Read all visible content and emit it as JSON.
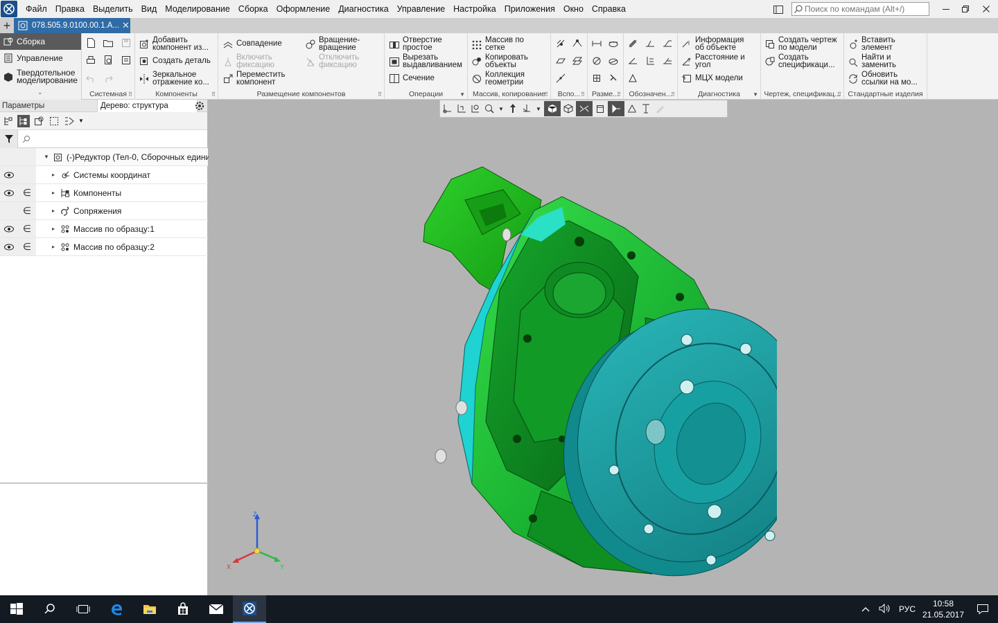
{
  "menubar": {
    "items": [
      "Файл",
      "Правка",
      "Выделить",
      "Вид",
      "Моделирование",
      "Сборка",
      "Оформление",
      "Диагностика",
      "Управление",
      "Настройка",
      "Приложения",
      "Окно",
      "Справка"
    ],
    "search_placeholder": "Поиск по командам (Alt+/)"
  },
  "tab": {
    "title": "078.505.9.0100.00.1.А...",
    "new_symbol": "+",
    "close_symbol": "✕"
  },
  "modes": {
    "items": [
      "Сборка",
      "Управление",
      "Твердотельное моделирование"
    ]
  },
  "ribbon": {
    "groups": {
      "system": "Системная",
      "components": "Компоненты",
      "placement": "Размещение компонентов",
      "operations": "Операции",
      "array": "Массив, копирование",
      "aux": "Вспо...",
      "size": "Разме...",
      "notation": "Обозначен...",
      "diag": "Диагностика",
      "drawing": "Чертеж, спецификац...",
      "standard": "Стандартные изделия"
    },
    "buttons": {
      "add_component": [
        "Добавить",
        "компонент из..."
      ],
      "create_part": "Создать деталь",
      "mirror": [
        "Зеркальное",
        "отражение ко..."
      ],
      "coincidence": "Совпадение",
      "enable_fix": [
        "Включить",
        "фиксацию"
      ],
      "move_component": [
        "Переместить",
        "компонент"
      ],
      "rotation": [
        "Вращение-",
        "вращение"
      ],
      "disable_fix": [
        "Отключить",
        "фиксацию"
      ],
      "hole": [
        "Отверстие",
        "простое"
      ],
      "cut_extrude": [
        "Вырезать",
        "выдавливанием"
      ],
      "section": "Сечение",
      "grid_array": [
        "Массив по",
        "сетке"
      ],
      "copy_objects": [
        "Копировать",
        "объекты"
      ],
      "geometry_collection": [
        "Коллекция",
        "геометрии"
      ],
      "object_info": [
        "Информация",
        "об объекте"
      ],
      "distance_angle": [
        "Расстояние и",
        "угол"
      ],
      "mass_props": "МЦХ модели",
      "create_drawing": [
        "Создать чертеж",
        "по модели"
      ],
      "create_spec": [
        "Создать",
        "спецификаци..."
      ],
      "insert_element": [
        "Вставить",
        "элемент"
      ],
      "find_replace": [
        "Найти и",
        "заменить"
      ],
      "update_links": [
        "Обновить",
        "ссылки на мо..."
      ]
    }
  },
  "left_panel": {
    "tabs": [
      "Параметры",
      "Дерево: структура"
    ],
    "tree": [
      {
        "label": "Редуктор (Тел-0, Сборочных едини",
        "eye": false,
        "link": false,
        "icon": "assembly-icon",
        "indent": 0
      },
      {
        "label": "Системы координат",
        "eye": true,
        "link": false,
        "icon": "coordinate-system-icon",
        "indent": 1
      },
      {
        "label": "Компоненты",
        "eye": true,
        "link": true,
        "icon": "components-icon",
        "indent": 1
      },
      {
        "label": "Сопряжения",
        "eye": false,
        "link": true,
        "icon": "mates-icon",
        "indent": 1
      },
      {
        "label": "Массив по образцу:1",
        "eye": true,
        "link": true,
        "icon": "pattern-icon",
        "indent": 1
      },
      {
        "label": "Массив по образцу:2",
        "eye": true,
        "link": true,
        "icon": "pattern-icon",
        "indent": 1
      }
    ]
  },
  "triad": {
    "x": "X",
    "y": "Y",
    "z": "Z"
  },
  "taskbar": {
    "lang": "РУС",
    "time": "10:58",
    "date": "21.05.2017"
  },
  "colors": {
    "accent": "#2f6ba6",
    "model_green": "#1fbf3a",
    "model_teal": "#1aa5a8",
    "viewport": "#b4b4b4"
  }
}
